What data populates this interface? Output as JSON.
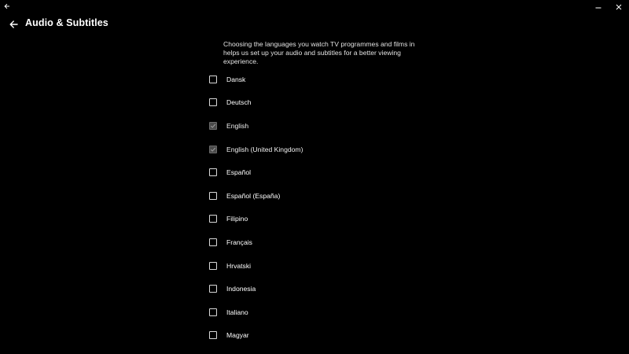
{
  "window": {
    "controls": [
      "minimize",
      "close"
    ]
  },
  "header": {
    "title": "Audio & Subtitles"
  },
  "description": "Choosing the languages you watch TV programmes and films in helps us set up your audio and subtitles for a better viewing experience.",
  "languages": [
    {
      "label": "Dansk",
      "checked": false
    },
    {
      "label": "Deutsch",
      "checked": false
    },
    {
      "label": "English",
      "checked": true
    },
    {
      "label": "English (United Kingdom)",
      "checked": true
    },
    {
      "label": "Español",
      "checked": false
    },
    {
      "label": "Español (España)",
      "checked": false
    },
    {
      "label": "Filipino",
      "checked": false
    },
    {
      "label": "Français",
      "checked": false
    },
    {
      "label": "Hrvatski",
      "checked": false
    },
    {
      "label": "Indonesia",
      "checked": false
    },
    {
      "label": "Italiano",
      "checked": false
    },
    {
      "label": "Magyar",
      "checked": false
    },
    {
      "label": "",
      "checked": false
    }
  ],
  "colors": {
    "background": "#000000",
    "text": "#ffffff",
    "checkbox_border": "#d8d8d8",
    "checkbox_checked": "#4a4a4a"
  }
}
